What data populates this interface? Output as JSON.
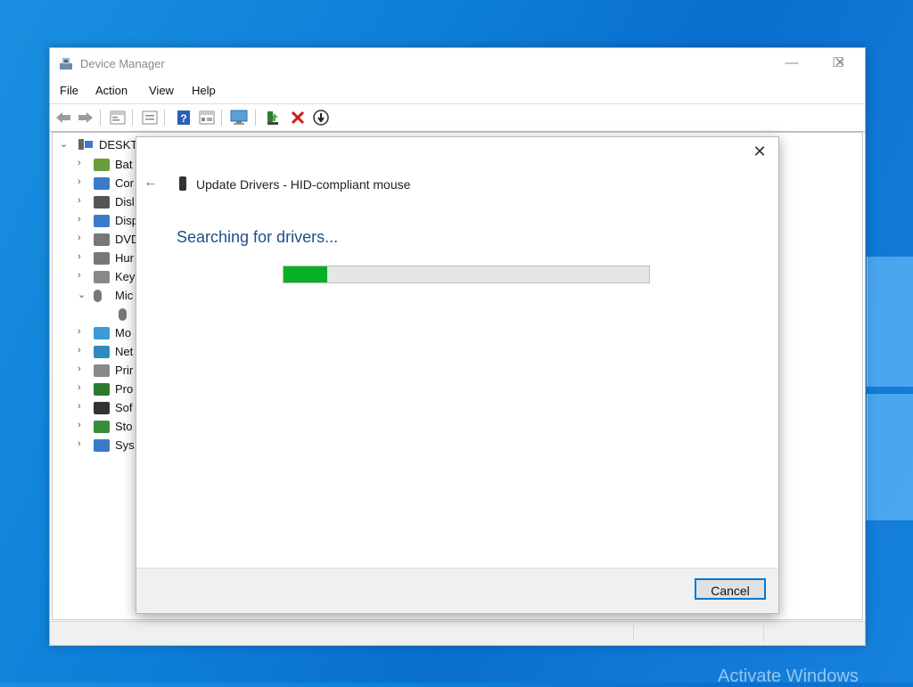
{
  "window": {
    "title": "Device Manager",
    "controls": {
      "minimize": "—",
      "maximize": "☐",
      "close": "✕"
    }
  },
  "menu": [
    "File",
    "Action",
    "View",
    "Help"
  ],
  "toolbar_icons": [
    "back-icon",
    "forward-icon",
    "properties-icon",
    "show-hide-icon",
    "help-icon",
    "view-icon",
    "computer-scan-icon",
    "update-driver-icon",
    "uninstall-icon",
    "enable-device-icon"
  ],
  "tree": {
    "root": "DESKTO",
    "items": [
      {
        "label": "Bat",
        "icon": "battery-icon"
      },
      {
        "label": "Cor",
        "icon": "computer-icon"
      },
      {
        "label": "Disl",
        "icon": "disk-drive-icon"
      },
      {
        "label": "Disp",
        "icon": "display-adapter-icon"
      },
      {
        "label": "DVD",
        "icon": "dvd-drive-icon"
      },
      {
        "label": "Hur",
        "icon": "hid-icon"
      },
      {
        "label": "Key",
        "icon": "keyboard-icon"
      },
      {
        "label": "Mic",
        "icon": "mouse-icon",
        "expanded": true
      },
      {
        "label": "",
        "icon": "mouse-device-icon",
        "child": true
      },
      {
        "label": "Mo",
        "icon": "monitor-icon"
      },
      {
        "label": "Net",
        "icon": "network-adapter-icon"
      },
      {
        "label": "Prir",
        "icon": "print-queue-icon"
      },
      {
        "label": "Pro",
        "icon": "processor-icon"
      },
      {
        "label": "Sof",
        "icon": "software-device-icon"
      },
      {
        "label": "Sto",
        "icon": "storage-controller-icon"
      },
      {
        "label": "Sys",
        "icon": "system-device-icon"
      }
    ]
  },
  "dialog": {
    "title": "Update Drivers - HID-compliant mouse",
    "heading": "Searching for drivers...",
    "progress_fraction": 0.12,
    "cancel_label": "Cancel",
    "close_glyph": "✕",
    "back_glyph": "←"
  },
  "desktop": {
    "watermark": "Activate Windows"
  },
  "colors": {
    "heading": "#1f4e8c",
    "progress": "#06b025",
    "accent": "#0078d7"
  }
}
